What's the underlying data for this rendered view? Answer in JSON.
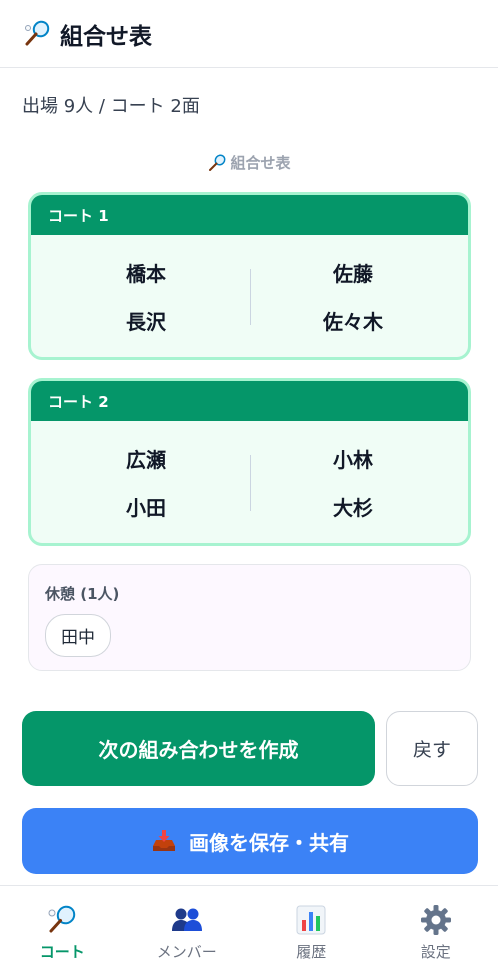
{
  "header": {
    "icon": "badminton-racket-icon",
    "title": "組合せ表"
  },
  "summary": "出場 9人 / コート 2面",
  "section": {
    "icon": "badminton-racket-icon",
    "title": "組合せ表"
  },
  "courts": [
    {
      "label": "コート 1",
      "team_a": [
        "橋本",
        "長沢"
      ],
      "team_b": [
        "佐藤",
        "佐々木"
      ]
    },
    {
      "label": "コート 2",
      "team_a": [
        "広瀬",
        "小田"
      ],
      "team_b": [
        "小林",
        "大杉"
      ]
    }
  ],
  "rest": {
    "title": "休憩 (1人)",
    "players": [
      "田中"
    ]
  },
  "actions": {
    "next_label": "次の組み合わせを作成",
    "back_label": "戻す",
    "share_icon": "inbox-tray-icon",
    "share_label": "画像を保存・共有"
  },
  "nav": [
    {
      "label": "コート",
      "icon": "badminton-racket-icon",
      "active": true
    },
    {
      "label": "メンバー",
      "icon": "people-icon",
      "active": false
    },
    {
      "label": "履歴",
      "icon": "bar-chart-icon",
      "active": false
    },
    {
      "label": "設定",
      "icon": "gear-icon",
      "active": false
    }
  ],
  "colors": {
    "accent": "#059669",
    "share": "#3b82f6",
    "court_border": "#a7f3d0",
    "court_bg": "#f0fdf6"
  }
}
